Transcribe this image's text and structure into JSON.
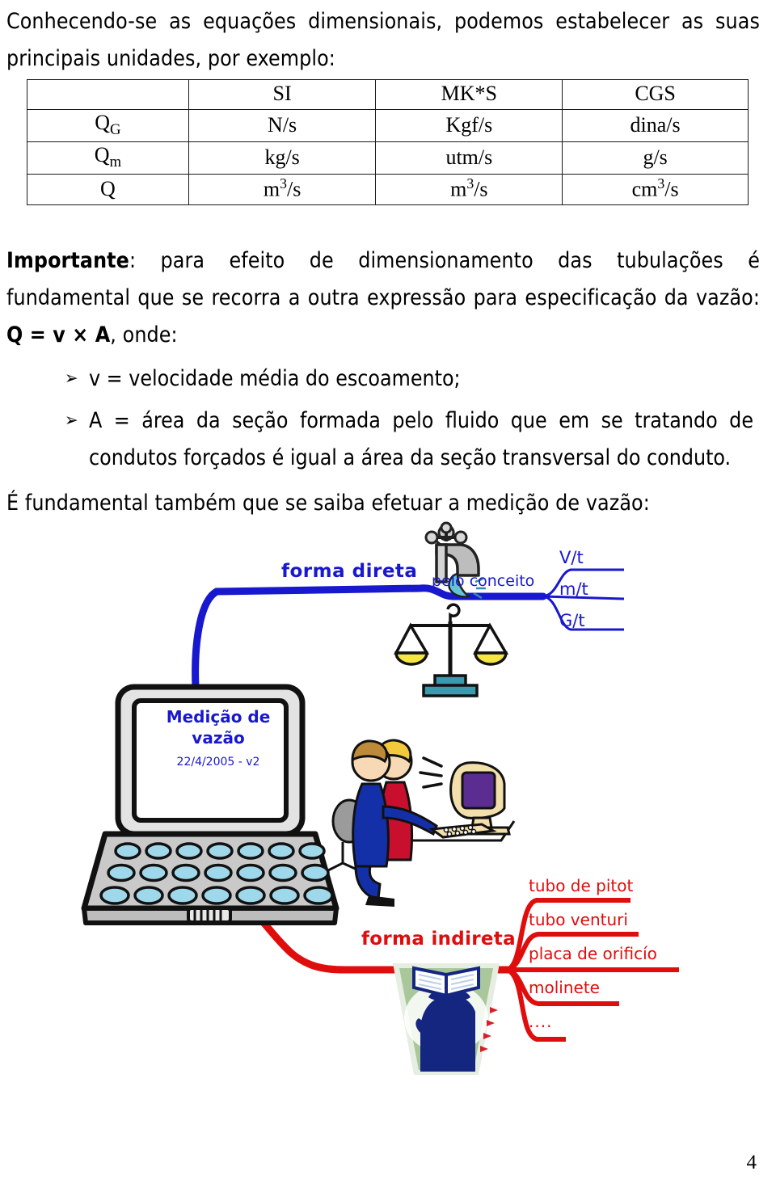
{
  "document": {
    "page_number": "4",
    "intro_paragraph": "Conhecendo-se as equações dimensionais, podemos estabelecer as suas principais unidades, por exemplo:",
    "important_label": "Importante",
    "important_rest": ": para efeito de dimensionamento das tubulações é fundamental que se recorra a outra expressão para especificação da vazão: ",
    "formula": "Q = v × A",
    "formula_tail": ", onde:",
    "bullets": [
      {
        "marker": "➢",
        "text": "v = velocidade média do escoamento;"
      },
      {
        "marker": "➢",
        "text": "A = área da seção formada pelo fluido que em se tratando de condutos forçados é igual a área da seção transversal do conduto."
      }
    ],
    "closing_paragraph": "É fundamental também que se saiba efetuar a medição de vazão:"
  },
  "units_table": {
    "columns": [
      "",
      "SI",
      "MK*S",
      "CGS"
    ],
    "rows": [
      {
        "symbol": "Q",
        "subscript": "G",
        "si": "N/s",
        "mks": "Kgf/s",
        "cgs": "dina/s"
      },
      {
        "symbol": "Q",
        "subscript": "m",
        "si": "kg/s",
        "mks": "utm/s",
        "cgs": "g/s"
      },
      {
        "symbol": "Q",
        "subscript": "",
        "si": "m3/s",
        "mks": "m3/s",
        "cgs": "cm3/s"
      }
    ]
  },
  "mindmap": {
    "center": {
      "title_line1": "Medição de",
      "title_line2": "vazão",
      "date": "22/4/2005 - v2"
    },
    "colors": {
      "direct_branch": "#1818cf",
      "indirect_branch": "#e00d0d"
    },
    "direct": {
      "label": "forma direta",
      "sublabel": "pelo conceito",
      "leaves": [
        "V/t",
        "m/t",
        "G/t"
      ]
    },
    "indirect": {
      "label": "forma indireta",
      "leaves": [
        "tubo de pitot",
        "tubo venturi",
        "placa de orificío",
        "molinete",
        "...."
      ]
    },
    "icons": {
      "faucet": "faucet-icon",
      "balance": "balance-scale-icon",
      "people_computer": "people-at-computer-icon",
      "laptop": "laptop-icon",
      "logo": "head-book-plant-logo"
    }
  }
}
